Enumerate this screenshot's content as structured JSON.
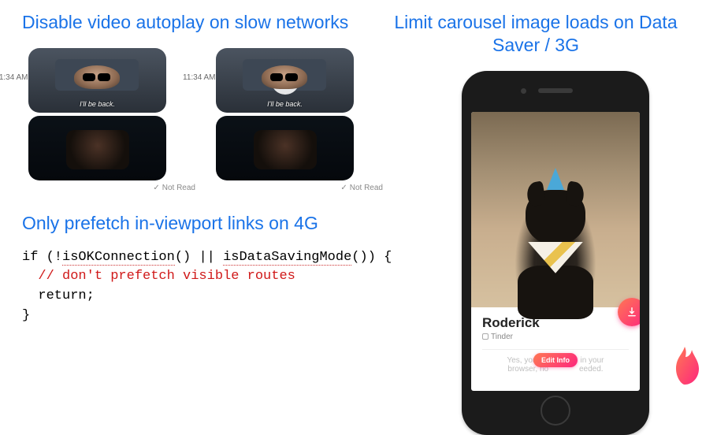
{
  "left": {
    "heading1": "Disable video autoplay on slow networks",
    "chat": {
      "timestamp": "11:34 AM",
      "caption": "I'll be back.",
      "not_read": "Not Read",
      "check": "✓"
    },
    "heading2": "Only prefetch in-viewport links on 4G",
    "code": {
      "line1a": "if (!",
      "fn1": "isOKConnection",
      "line1b": "() || ",
      "fn2": "isDataSavingMode",
      "line1c": "()) {",
      "comment": "  // don't prefetch visible routes",
      "line3": "  return;",
      "line4": "}"
    }
  },
  "right": {
    "heading": "Limit carousel image loads on Data Saver / 3G",
    "profile": {
      "name": "Roderick",
      "subtitle": "Tinder",
      "muted_a": "Yes, you can",
      "muted_b": "in your",
      "muted_c": "browser, no",
      "muted_d": "eeded.",
      "edit": "Edit Info"
    }
  }
}
